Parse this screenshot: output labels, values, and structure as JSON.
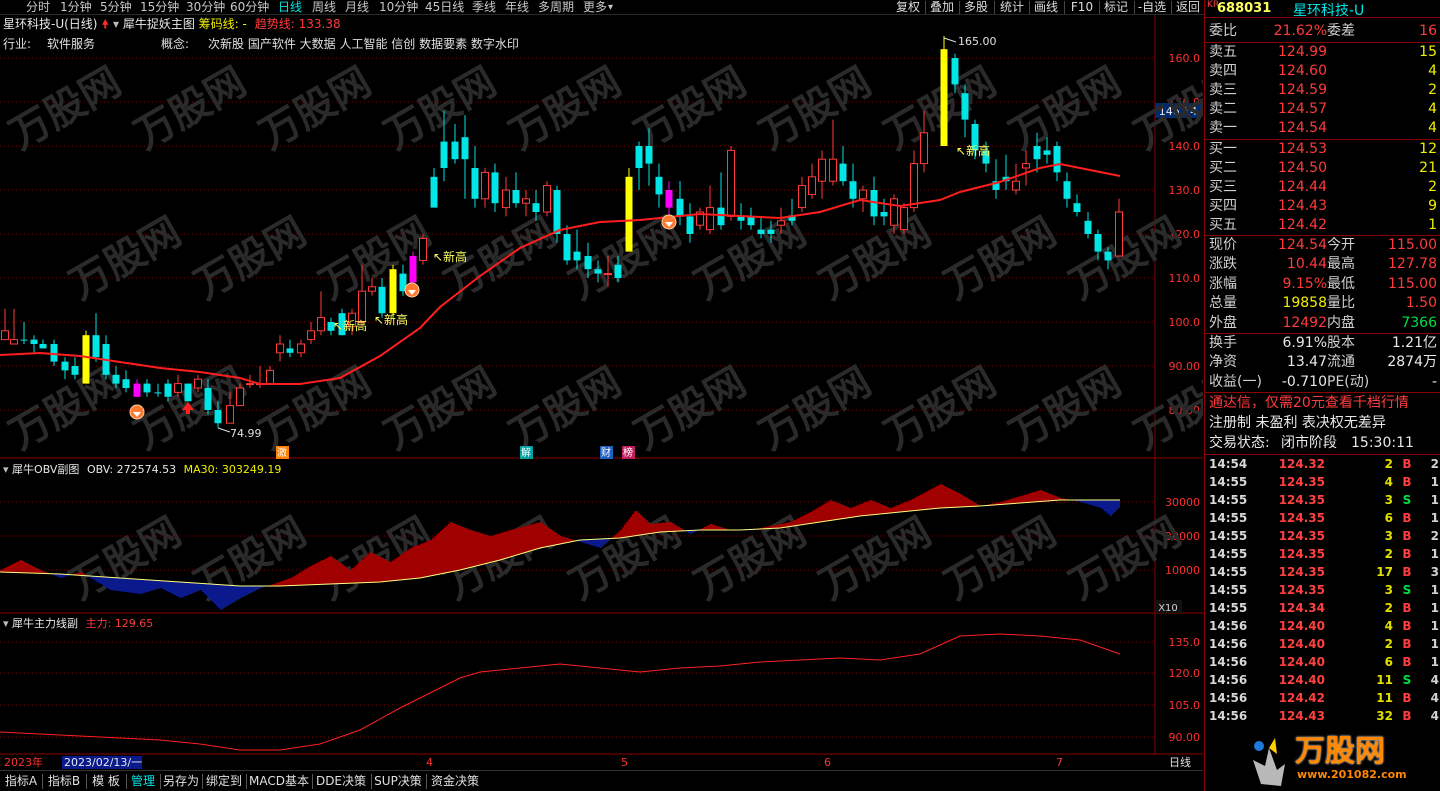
{
  "topbar": {
    "periods": [
      "分时",
      "1分钟",
      "5分钟",
      "15分钟",
      "30分钟",
      "60分钟",
      "日线",
      "周线",
      "月线",
      "10分钟",
      "45日线",
      "季线",
      "年线",
      "多周期",
      "更多"
    ],
    "active_index": 6,
    "more_arrow": "▾",
    "tools": [
      "复权",
      "叠加",
      "多股",
      "统计",
      "画线",
      "F10",
      "标记",
      "-自选",
      "返回"
    ]
  },
  "stock": {
    "name": "星环科技-U(日线)",
    "indicator_name": "犀牛捉妖主图",
    "line1_label": "筹码线:",
    "line1_value": "-",
    "line2_label": "趋势线:",
    "line2_value": "133.38",
    "industry_label": "行业:",
    "industry_value": "软件服务",
    "concept_label": "概念:",
    "concept_value": "次新股 国产软件 大数据 人工智能 信创 数据要素 数字水印"
  },
  "price_axis": [
    "160.0",
    "150.0",
    "140.0",
    "130.0",
    "120.0",
    "110.0",
    "100.0",
    "90.00",
    "80.00"
  ],
  "price_tag": "146.14",
  "annotations": {
    "high": "165.00",
    "low": "74.99",
    "new_high": "新高",
    "events": [
      "激",
      "解",
      "财",
      "榜"
    ]
  },
  "obv_panel": {
    "title": "犀牛OBV副图",
    "obv_label": "OBV:",
    "obv_value": "272574.53",
    "ma_label": "MA30:",
    "ma_value": "303249.19",
    "axis": [
      "30000",
      "20000",
      "10000"
    ],
    "scale": "X10"
  },
  "main_panel": {
    "title": "犀牛主力线副",
    "label": "主力:",
    "value": "129.65",
    "axis": [
      "135.0",
      "120.0",
      "105.0",
      "90.00"
    ]
  },
  "date_axis": {
    "year": "2023年",
    "cursor_date": "2023/02/13/一",
    "months": [
      "4",
      "5",
      "6",
      "7"
    ],
    "period": "日线"
  },
  "tabs": [
    "指标A",
    "指标B",
    "模 板",
    "管理",
    "另存为",
    "绑定到",
    "MACD基本",
    "DDE决策",
    "SUP决策",
    "资金决策"
  ],
  "tabs_active_index": 3,
  "right": {
    "code": "688031",
    "name": "星环科技-U",
    "wei_bi_label": "委比",
    "wei_bi": "21.62%",
    "wei_cha_label": "委差",
    "wei_cha": "16",
    "asks": [
      {
        "label": "卖五",
        "price": "124.99",
        "vol": "15"
      },
      {
        "label": "卖四",
        "price": "124.60",
        "vol": "4"
      },
      {
        "label": "卖三",
        "price": "124.59",
        "vol": "2"
      },
      {
        "label": "卖二",
        "price": "124.57",
        "vol": "4"
      },
      {
        "label": "卖一",
        "price": "124.54",
        "vol": "4"
      }
    ],
    "bids": [
      {
        "label": "买一",
        "price": "124.53",
        "vol": "12"
      },
      {
        "label": "买二",
        "price": "124.50",
        "vol": "21"
      },
      {
        "label": "买三",
        "price": "124.44",
        "vol": "2"
      },
      {
        "label": "买四",
        "price": "124.43",
        "vol": "9"
      },
      {
        "label": "买五",
        "price": "124.42",
        "vol": "1"
      }
    ],
    "stats": [
      {
        "l1": "现价",
        "v1": "124.54",
        "c1": "red",
        "l2": "今开",
        "v2": "115.00",
        "c2": "red"
      },
      {
        "l1": "涨跌",
        "v1": "10.44",
        "c1": "red",
        "l2": "最高",
        "v2": "127.78",
        "c2": "red"
      },
      {
        "l1": "涨幅",
        "v1": "9.15%",
        "c1": "red",
        "l2": "最低",
        "v2": "115.00",
        "c2": "red"
      },
      {
        "l1": "总量",
        "v1": "19858",
        "c1": "yellow",
        "l2": "量比",
        "v2": "1.50",
        "c2": "red"
      },
      {
        "l1": "外盘",
        "v1": "12492",
        "c1": "red",
        "l2": "内盘",
        "v2": "7366",
        "c2": "green"
      }
    ],
    "stats2": [
      {
        "l1": "换手",
        "v1": "6.91%",
        "c1": "white",
        "l2": "股本",
        "v2": "1.21亿",
        "c2": "white"
      },
      {
        "l1": "净资",
        "v1": "13.47",
        "c1": "white",
        "l2": "流通",
        "v2": "2874万",
        "c2": "white"
      },
      {
        "l1": "收益(一)",
        "v1": "-0.710",
        "c1": "white",
        "l2": "PE(动)",
        "v2": "-",
        "c2": "white"
      }
    ],
    "promo": "通达信，仅需20元查看千档行情",
    "reg": "注册制 未盈利 表决权无差异",
    "status_label": "交易状态:",
    "status_value": "闭市阶段",
    "status_time": "15:30:11",
    "ticks": [
      {
        "t": "14:54",
        "p": "124.32",
        "q": "2",
        "bs": "B",
        "n": "2"
      },
      {
        "t": "14:55",
        "p": "124.35",
        "q": "4",
        "bs": "B",
        "n": "1"
      },
      {
        "t": "14:55",
        "p": "124.35",
        "q": "3",
        "bs": "S",
        "n": "1"
      },
      {
        "t": "14:55",
        "p": "124.35",
        "q": "6",
        "bs": "B",
        "n": "1"
      },
      {
        "t": "14:55",
        "p": "124.35",
        "q": "3",
        "bs": "B",
        "n": "2"
      },
      {
        "t": "14:55",
        "p": "124.35",
        "q": "2",
        "bs": "B",
        "n": "1"
      },
      {
        "t": "14:55",
        "p": "124.35",
        "q": "17",
        "bs": "B",
        "n": "3"
      },
      {
        "t": "14:55",
        "p": "124.35",
        "q": "3",
        "bs": "S",
        "n": "1"
      },
      {
        "t": "14:55",
        "p": "124.34",
        "q": "2",
        "bs": "B",
        "n": "1"
      },
      {
        "t": "14:56",
        "p": "124.40",
        "q": "4",
        "bs": "B",
        "n": "1"
      },
      {
        "t": "14:56",
        "p": "124.40",
        "q": "2",
        "bs": "B",
        "n": "1"
      },
      {
        "t": "14:56",
        "p": "124.40",
        "q": "6",
        "bs": "B",
        "n": "1"
      },
      {
        "t": "14:56",
        "p": "124.40",
        "q": "11",
        "bs": "S",
        "n": "4"
      },
      {
        "t": "14:56",
        "p": "124.42",
        "q": "11",
        "bs": "B",
        "n": "4"
      },
      {
        "t": "14:56",
        "p": "124.43",
        "q": "32",
        "bs": "B",
        "n": "4"
      }
    ],
    "watermark": "万股网",
    "watermark_url": "www.201082.com"
  },
  "colors": {
    "up": "#ff3b3b",
    "down": "#00e5e5",
    "yellow_candle": "#ffff00",
    "magenta_candle": "#ff00ff",
    "trend": "#ff1e1e",
    "obv_fill_up": "#a00000",
    "obv_fill_down": "#0a1a8c",
    "ma_line": "#ffff80",
    "grid": "#7a0000"
  }
}
